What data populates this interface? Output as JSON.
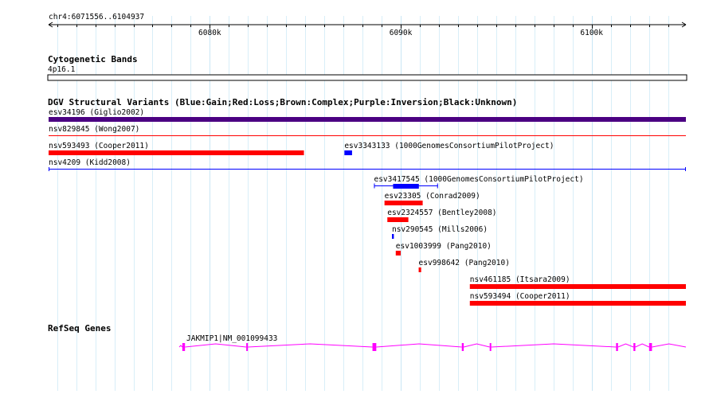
{
  "ruler": {
    "region_label": "chr4:6071556..6104937",
    "ticks": [
      {
        "label": "6080k",
        "pos": 6080000
      },
      {
        "label": "6090k",
        "pos": 6090000
      },
      {
        "label": "6100k",
        "pos": 6100000
      }
    ]
  },
  "region": {
    "start": 6071556,
    "end": 6104937
  },
  "cytoband": {
    "title": "Cytogenetic Bands",
    "band": "4p16.1"
  },
  "dgv": {
    "title": "DGV Structural Variants (Blue:Gain;Red:Loss;Brown:Complex;Purple:Inversion;Black:Unknown)",
    "colors": {
      "gain": "#0000ff",
      "loss": "#ff0000",
      "inversion": "#4b0082"
    },
    "features": [
      {
        "label": "esv34196 (Giglio2002)",
        "start": 6071556,
        "end": 6104937,
        "type": "inversion",
        "row": 0,
        "style": "thick"
      },
      {
        "label": "nsv829845 (Wong2007)",
        "start": 6071556,
        "end": 6104937,
        "type": "loss",
        "row": 1,
        "style": "thin"
      },
      {
        "label": "nsv593493 (Cooper2011)",
        "start": 6071556,
        "end": 6084930,
        "type": "loss",
        "row": 2,
        "style": "medium"
      },
      {
        "label": "esv3343133 (1000GenomesConsortiumPilotProject)",
        "start": 6087050,
        "end": 6087450,
        "type": "gain",
        "row": 2,
        "style": "medium"
      },
      {
        "label": "nsv4209 (Kidd2008)",
        "start": 6071556,
        "end": 6104937,
        "type": "gain",
        "row": 3,
        "style": "line"
      },
      {
        "label": "esv3417545 (1000GenomesConsortiumPilotProject)",
        "start": 6088600,
        "end": 6091950,
        "type": "gain",
        "row": 4,
        "style": "capped",
        "core_start": 6089600,
        "core_end": 6090950
      },
      {
        "label": "esv23305 (Conrad2009)",
        "start": 6089150,
        "end": 6091150,
        "type": "loss",
        "row": 5,
        "style": "medium"
      },
      {
        "label": "esv2324557 (Bentley2008)",
        "start": 6089300,
        "end": 6090400,
        "type": "loss",
        "row": 6,
        "style": "medium"
      },
      {
        "label": "nsv290545 (Mills2006)",
        "start": 6089540,
        "end": 6089640,
        "type": "gain",
        "row": 7,
        "style": "medium"
      },
      {
        "label": "esv1003999 (Pang2010)",
        "start": 6089740,
        "end": 6090000,
        "type": "loss",
        "row": 8,
        "style": "medium"
      },
      {
        "label": "esv998642 (Pang2010)",
        "start": 6090940,
        "end": 6091070,
        "type": "loss",
        "row": 9,
        "style": "medium"
      },
      {
        "label": "nsv461185 (Itsara2009)",
        "start": 6093620,
        "end": 6104937,
        "type": "loss",
        "row": 10,
        "style": "medium"
      },
      {
        "label": "nsv593494 (Cooper2011)",
        "start": 6093620,
        "end": 6104937,
        "type": "loss",
        "row": 11,
        "style": "medium"
      }
    ]
  },
  "refseq": {
    "title": "RefSeq Genes",
    "gene_label": "JAKMIP1|NM_001099433",
    "color": "#ff00ff",
    "gene_start": 6078400,
    "gene_end": 6104937,
    "exons": [
      {
        "start": 6078560,
        "end": 6078700
      },
      {
        "start": 6081910,
        "end": 6081990
      },
      {
        "start": 6088520,
        "end": 6088720
      },
      {
        "start": 6093200,
        "end": 6093300
      },
      {
        "start": 6094660,
        "end": 6094740
      },
      {
        "start": 6101280,
        "end": 6101380
      },
      {
        "start": 6102190,
        "end": 6102290
      },
      {
        "start": 6103010,
        "end": 6103160
      }
    ]
  }
}
